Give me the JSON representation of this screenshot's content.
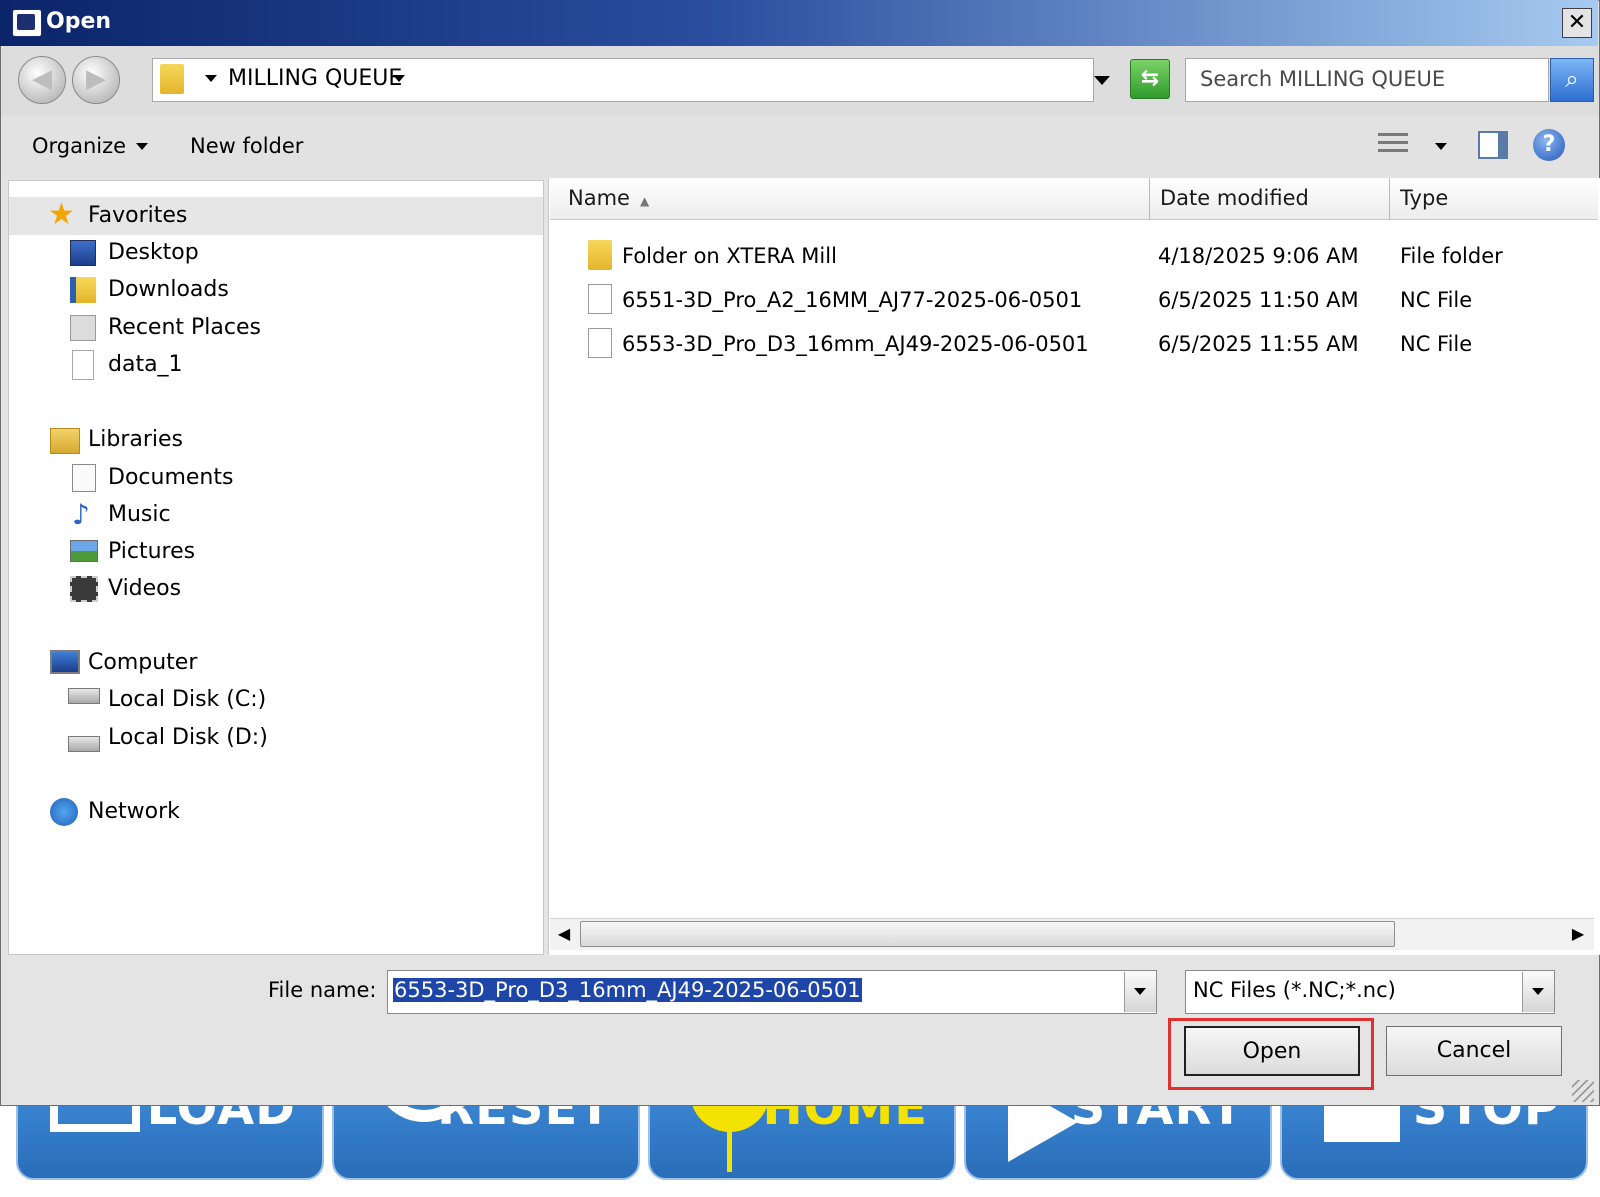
{
  "background_app": {
    "buttons": [
      {
        "label": "LOAD"
      },
      {
        "label": "RESET"
      },
      {
        "label": "HOME"
      },
      {
        "label": "START"
      },
      {
        "label": "STOP"
      }
    ]
  },
  "dialog": {
    "title": "Open",
    "close_label": "✕",
    "address": {
      "folder": "MILLING QUEUE"
    },
    "search": {
      "placeholder": "Search MILLING QUEUE"
    },
    "toolbar": {
      "organize": "Organize",
      "new_folder": "New folder"
    },
    "nav": {
      "favorites": {
        "label": "Favorites",
        "items": [
          {
            "label": "Desktop",
            "icon": "desktop-icon"
          },
          {
            "label": "Downloads",
            "icon": "downloads-icon"
          },
          {
            "label": "Recent Places",
            "icon": "recent-places-icon"
          },
          {
            "label": "data_1",
            "icon": "file-icon"
          }
        ]
      },
      "libraries": {
        "label": "Libraries",
        "items": [
          {
            "label": "Documents",
            "icon": "documents-icon"
          },
          {
            "label": "Music",
            "icon": "music-icon"
          },
          {
            "label": "Pictures",
            "icon": "pictures-icon"
          },
          {
            "label": "Videos",
            "icon": "videos-icon"
          }
        ]
      },
      "computer": {
        "label": "Computer",
        "items": [
          {
            "label": "Local Disk (C:)",
            "icon": "disk-icon"
          },
          {
            "label": "Local Disk (D:)",
            "icon": "disk-icon"
          }
        ]
      },
      "network": {
        "label": "Network"
      }
    },
    "columns": {
      "name": "Name",
      "date_modified": "Date modified",
      "type": "Type"
    },
    "files": [
      {
        "name": "Folder on XTERA Mill",
        "date": "4/18/2025 9:06 AM",
        "type": "File folder",
        "icon": "folder-icon"
      },
      {
        "name": "6551-3D_Pro_A2_16MM_AJ77-2025-06-0501",
        "date": "6/5/2025 11:50 AM",
        "type": "NC File",
        "icon": "nc-file-icon"
      },
      {
        "name": "6553-3D_Pro_D3_16mm_AJ49-2025-06-0501",
        "date": "6/5/2025 11:55 AM",
        "type": "NC File",
        "icon": "nc-file-icon"
      }
    ],
    "file_name_label": "File name:",
    "file_name_value": "6553-3D_Pro_D3_16mm_AJ49-2025-06-0501",
    "file_type_value": "NC Files (*.NC;*.nc)",
    "buttons": {
      "open": "Open",
      "cancel": "Cancel"
    }
  }
}
